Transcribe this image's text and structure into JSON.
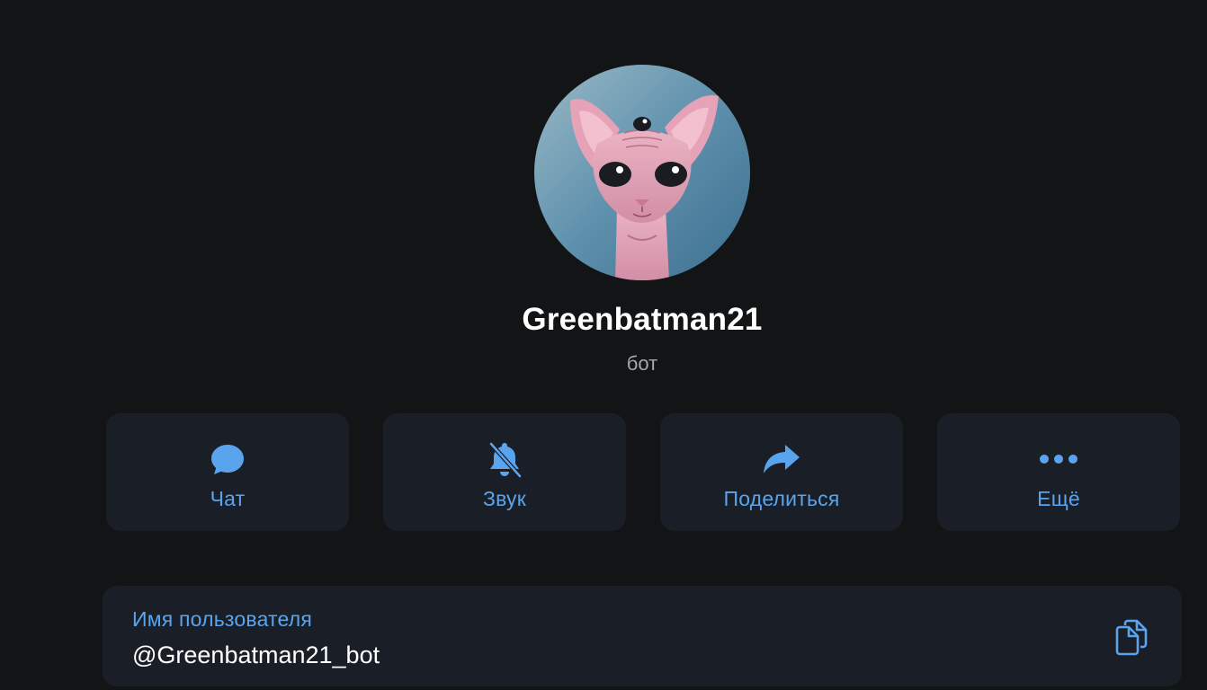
{
  "profile": {
    "name": "Greenbatman21",
    "status": "бот",
    "avatar_icon": "sphynx-cat-avatar"
  },
  "actions": [
    {
      "label": "Чат",
      "icon": "chat-bubble-icon"
    },
    {
      "label": "Звук",
      "icon": "bell-muted-icon"
    },
    {
      "label": "Поделиться",
      "icon": "share-arrow-icon"
    },
    {
      "label": "Ещё",
      "icon": "more-dots-icon"
    }
  ],
  "username": {
    "label": "Имя пользователя",
    "value": "@Greenbatman21_bot",
    "copy_icon": "copy-icon"
  },
  "colors": {
    "background": "#121416",
    "card": "#1a1f27",
    "accent": "#5aa4ee",
    "secondary_text": "#a4a8ae"
  }
}
